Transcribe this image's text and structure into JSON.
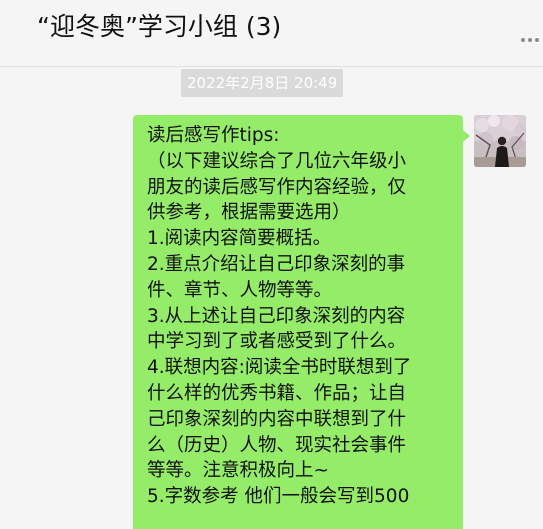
{
  "header": {
    "title": "“迎冬奥”学习小组 (3)"
  },
  "chat": {
    "timestamp": "2022年2月8日 20:49",
    "message": {
      "lines": [
        "读后感写作tips:",
        "（以下建议综合了几位六年级小",
        "朋友的读后感写作内容经验，仅",
        "供参考，根据需要选用）",
        "1.阅读内容简要概括。",
        "2.重点介绍让自己印象深刻的事",
        "件、章节、人物等等。",
        "3.从上述让自己印象深刻的内容",
        "中学习到了或者感受到了什么。",
        "4.联想内容:阅读全书时联想到了",
        "什么样的优秀书籍、作品；让自",
        "己印象深刻的内容中联想到了什",
        "么（历史）人物、现实社会事件",
        "等等。注意积极向上~",
        "5.字数参考 他们一般会写到500"
      ]
    }
  },
  "colors": {
    "window_bg": "#f5f5f5",
    "bubble_bg": "#95ec69",
    "timestamp_bg": "#dadada",
    "timestamp_text": "#ffffff",
    "text": "#111111"
  },
  "icons": {
    "more": "more-horizontal-icon"
  }
}
